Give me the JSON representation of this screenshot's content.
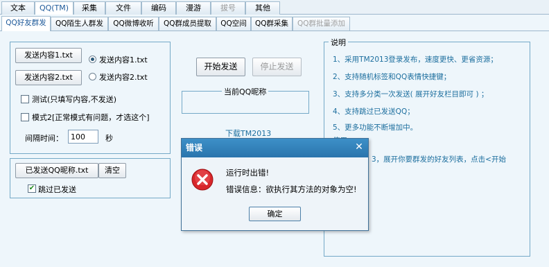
{
  "tabs_top": [
    {
      "label": "文本"
    },
    {
      "label": "QQ(TM)"
    },
    {
      "label": "采集"
    },
    {
      "label": "文件"
    },
    {
      "label": "编码"
    },
    {
      "label": "漫游"
    },
    {
      "label": "拔号"
    },
    {
      "label": "其他"
    }
  ],
  "tabs_sub": [
    {
      "label": "QQ好友群发"
    },
    {
      "label": "QQ陌生人群发"
    },
    {
      "label": "QQ微博收听"
    },
    {
      "label": "QQ群成员提取"
    },
    {
      "label": "QQ空间"
    },
    {
      "label": "QQ群采集"
    },
    {
      "label": "QQ群批量添加"
    }
  ],
  "send_panel": {
    "content1_button": "发送内容1.txt",
    "content1_radio": "发送内容1.txt",
    "content2_button": "发送内容2.txt",
    "content2_radio": "发送内容2.txt",
    "test_check": "测试(只填写内容,不发送)",
    "mode2_check": "模式2[正常模式有问题，才选这个]",
    "interval_label": "间隔时间：",
    "interval_value": "100",
    "interval_unit": "秒"
  },
  "sent_panel": {
    "sent_button": "已发送QQ昵称.txt",
    "clear_button": "清空",
    "skip_check": "跳过已发送"
  },
  "actions": {
    "start_button": "开始发送",
    "stop_button": "停止发送",
    "nickname_legend": "当前QQ昵称",
    "download_link": "下载TM2013"
  },
  "notes": {
    "legend": "说明",
    "items": [
      "1、采用TM2013登录发布，速度更快、更省资源；",
      "2、支持随机标签和QQ表情快捷键；",
      "3、支持多分类一次发送( 展开好友栏目即可 ) ；",
      "4、支持跳过已发送QQ；",
      "5、更多功能不断增加中。"
    ],
    "partial_legend": "使用",
    "partial_text": "3，展开你要群发的好友列表，点击<开始"
  },
  "dialog": {
    "title": "错误",
    "close": "✕",
    "message": "运行时出错!",
    "detail": "错误信息：欲执行其方法的对象为空!",
    "ok_button": "确定"
  },
  "colors": {
    "accent": "#2a74ad",
    "text_blue": "#1c6e9e",
    "error_red": "#d8262b"
  }
}
